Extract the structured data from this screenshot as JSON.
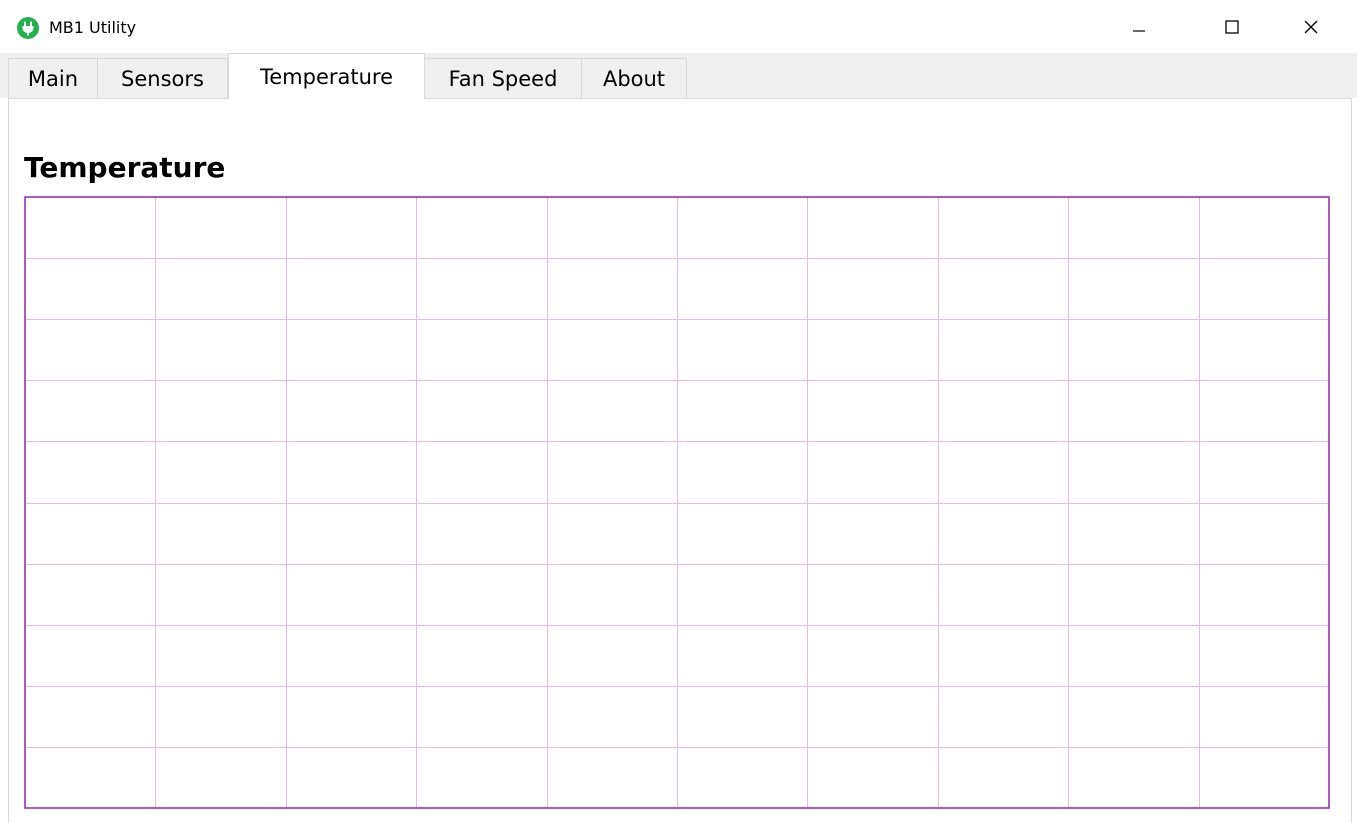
{
  "window": {
    "title": "MB1 Utility",
    "icon": "plug-icon",
    "controls": {
      "minimize": "minimize-icon",
      "maximize": "maximize-icon",
      "close": "close-icon"
    }
  },
  "tabs": [
    {
      "label": "Main",
      "active": false
    },
    {
      "label": "Sensors",
      "active": false
    },
    {
      "label": "Temperature",
      "active": true
    },
    {
      "label": "Fan Speed",
      "active": false
    },
    {
      "label": "About",
      "active": false
    }
  ],
  "content": {
    "heading": "Temperature"
  },
  "colors": {
    "accent": "#22b14c",
    "grid_line": "#e8b8ec",
    "chart_border": "#9b30b8",
    "tab_bg": "#f0f0f0",
    "tab_border": "#d9d9d9"
  },
  "chart_data": {
    "type": "line",
    "series": [],
    "grid": true,
    "grid_columns": 10,
    "grid_rows": 10,
    "title": "",
    "xlabel": "",
    "ylabel": ""
  }
}
